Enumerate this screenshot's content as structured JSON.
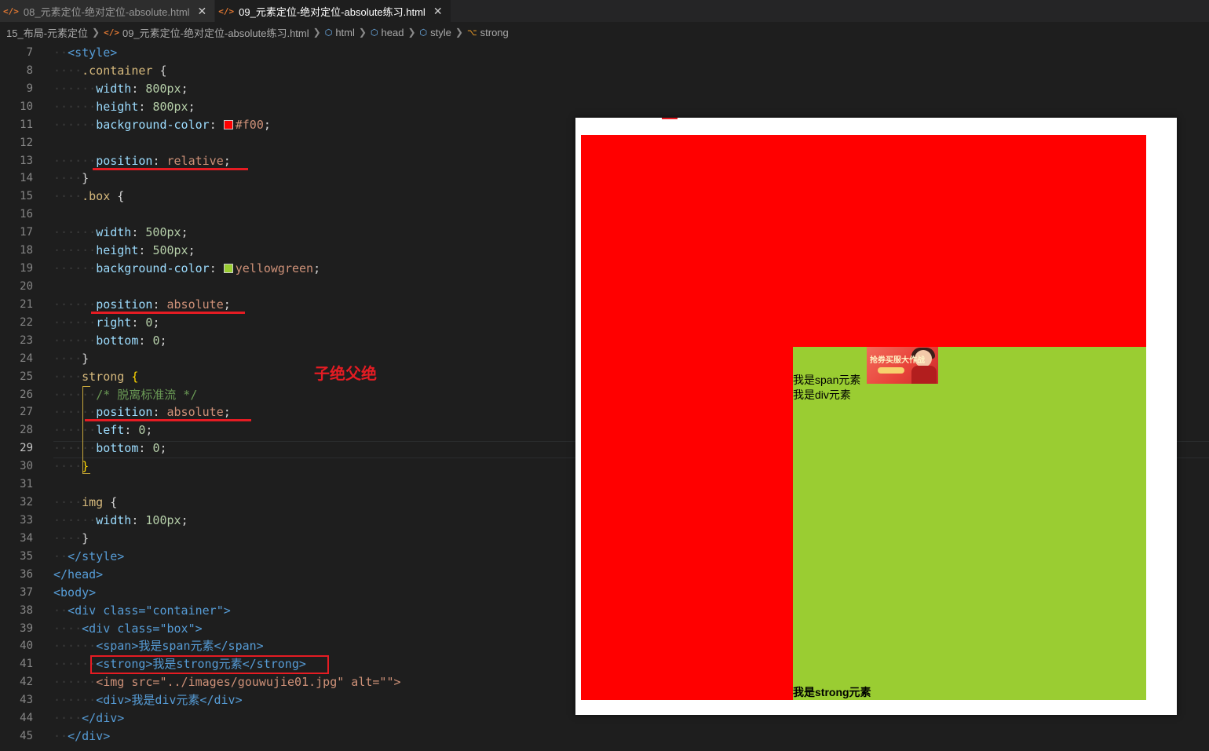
{
  "tabs": [
    {
      "label": "08_元素定位-绝对定位-absolute.html",
      "active": false
    },
    {
      "label": "09_元素定位-绝对定位-absolute练习.html",
      "active": true
    }
  ],
  "breadcrumb": [
    "15_布局-元素定位",
    "09_元素定位-绝对定位-absolute练习.html",
    "html",
    "head",
    "style",
    "strong"
  ],
  "editor": {
    "line_numbers": [
      "7",
      "8",
      "9",
      "10",
      "11",
      "12",
      "13",
      "14",
      "15",
      "16",
      "17",
      "18",
      "19",
      "20",
      "21",
      "22",
      "23",
      "24",
      "25",
      "26",
      "27",
      "28",
      "29",
      "30",
      "31",
      "32",
      "33",
      "34",
      "35",
      "36",
      "37",
      "38",
      "39",
      "40",
      "41",
      "42",
      "43",
      "44",
      "45"
    ],
    "current_line": "29",
    "colors": {
      "red_swatch": "#f00",
      "green_swatch": "#9acd32"
    },
    "code": {
      "style_open": "<style>",
      "container_sel": ".container",
      "brace_open": "{",
      "brace_close": "}",
      "width": "width",
      "height": "height",
      "bg": "background-color",
      "position": "position",
      "right": "right",
      "bottom": "bottom",
      "left": "left",
      "px800": "800px",
      "px500": "500px",
      "px100": "100px",
      "zero": "0",
      "f00": "#f00",
      "relative": "relative",
      "absolute": "absolute",
      "yellowgreen": "yellowgreen",
      "box_sel": ".box",
      "strong_sel": "strong",
      "comment": "/* 脱离标准流 */",
      "img_sel": "img",
      "style_close": "</style>",
      "head_close": "</head>",
      "body_open": "<body>",
      "div_container": "<div class=\"container\">",
      "div_box": "<div class=\"box\">",
      "span_line": "<span>我是span元素</span>",
      "strong_line": "<strong>我是strong元素</strong>",
      "img_line": "<img src=\"../images/gouwujie01.jpg\" alt=\"\">",
      "div_line": "<div>我是div元素</div>",
      "div_close": "</div>"
    }
  },
  "annotation": "子绝父绝",
  "preview": {
    "span_text": "我是span元素",
    "div_text": "我是div元素",
    "strong_text": "我是strong元素",
    "image_banner": "抢券买服大作战",
    "container_color": "#ff0000",
    "box_color": "#9acd32"
  }
}
